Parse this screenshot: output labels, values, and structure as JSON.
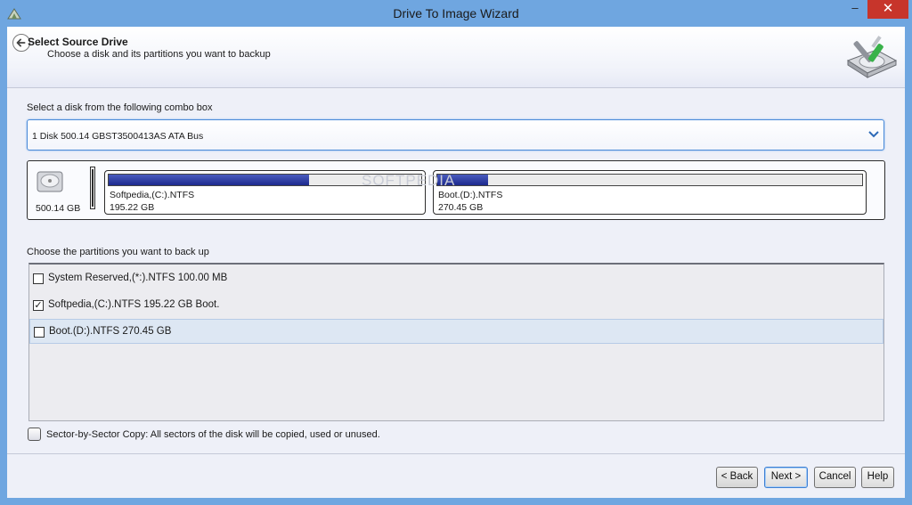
{
  "window": {
    "title": "Drive To Image Wizard",
    "minimize_glyph": "–",
    "close_glyph": "✕"
  },
  "header": {
    "title": "Select Source Drive",
    "subtitle": "Choose a disk and its partitions you want to backup"
  },
  "disk_select": {
    "label": "Select a disk from the following combo box",
    "selected": "1 Disk 500.14 GBST3500413AS ATA Bus"
  },
  "disk_map": {
    "disk_size": "500.14 GB",
    "partitions": [
      {
        "name": "Softpedia,(C:).NTFS",
        "size": "195.22 GB",
        "used_fraction": 0.64
      },
      {
        "name": "Boot.(D:).NTFS",
        "size": "270.45 GB",
        "used_fraction": 0.12
      }
    ],
    "watermark": "SOFTPEDIA"
  },
  "partition_list": {
    "label": "Choose the partitions you want to back up",
    "items": [
      {
        "label": "System Reserved,(*:).NTFS 100.00 MB",
        "checked": false
      },
      {
        "label": "Softpedia,(C:).NTFS 195.22 GB Boot.",
        "checked": true
      },
      {
        "label": "Boot.(D:).NTFS 270.45 GB",
        "checked": false
      }
    ]
  },
  "sector_copy": {
    "label": "Sector-by-Sector Copy: All sectors of the disk will be copied, used or unused.",
    "checked": false
  },
  "buttons": {
    "back": "< Back",
    "next": "Next >",
    "cancel": "Cancel",
    "help": "Help"
  },
  "colors": {
    "accent": "#4a8ad8",
    "used_space": "#1d2a8e",
    "close_button": "#c7352b"
  }
}
